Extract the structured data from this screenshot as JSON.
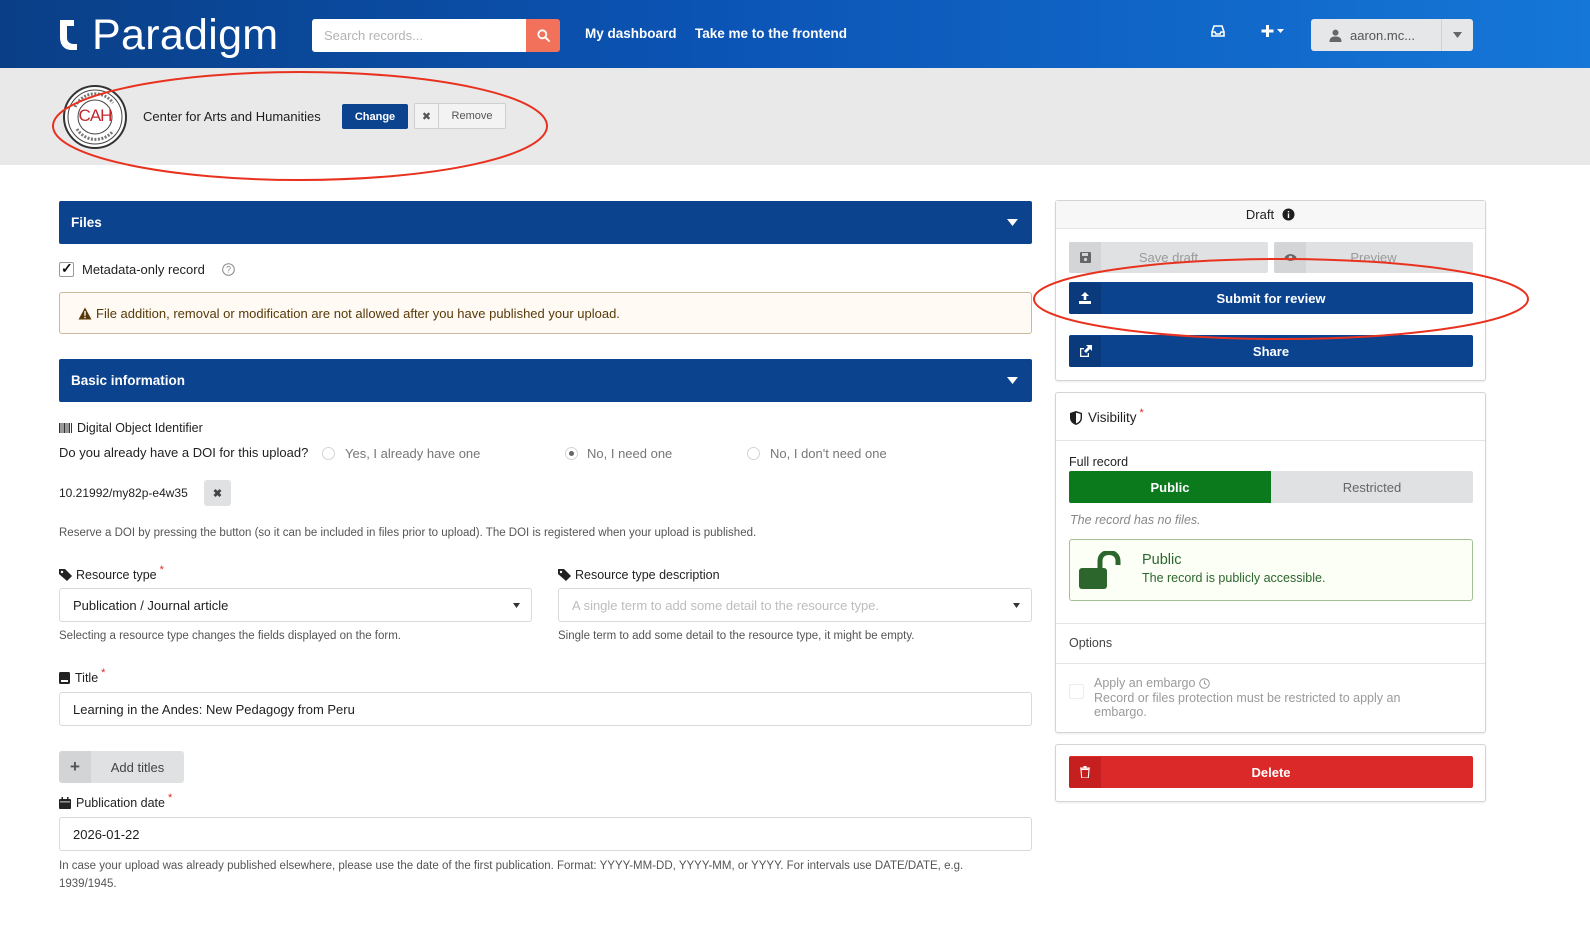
{
  "header": {
    "brand": "Paradigm",
    "search_placeholder": "Search records...",
    "nav": [
      "My dashboard",
      "Take me to the frontend"
    ],
    "user": "aaron.mc..."
  },
  "community": {
    "seal_text": "CAH",
    "name": "Center for Arts and Humanities",
    "change_label": "Change",
    "remove_label": "Remove"
  },
  "files": {
    "title": "Files",
    "metadata_only_label": "Metadata-only record",
    "metadata_only_checked": true,
    "warning": "File addition, removal or modification are not allowed after you have published your upload."
  },
  "basic": {
    "title": "Basic information",
    "doi_label": "Digital Object Identifier",
    "doi_question": "Do you already have a DOI for this upload?",
    "doi_options": [
      "Yes, I already have one",
      "No, I need one",
      "No, I don't need one"
    ],
    "doi_selected": 1,
    "doi_value": "10.21992/my82p-e4w35",
    "doi_help": "Reserve a DOI by pressing the button (so it can be included in files prior to upload). The DOI is registered when your upload is published.",
    "resource_type_label": "Resource type",
    "resource_type_value": "Publication / Journal article",
    "resource_type_help": "Selecting a resource type changes the fields displayed on the form.",
    "resource_desc_label": "Resource type description",
    "resource_desc_placeholder": "A single term to add some detail to the resource type.",
    "resource_desc_help": "Single term to add some detail to the resource type, it might be empty.",
    "title_label": "Title",
    "title_value": "Learning in the Andes: New Pedagogy from Peru",
    "add_titles_label": "Add titles",
    "pubdate_label": "Publication date",
    "pubdate_value": "2026-01-22",
    "pubdate_help_1": "In case your upload was already published elsewhere, please use the date of the first publication. Format: YYYY-MM-DD, YYYY-MM, or YYYY. For intervals use DATE/DATE, e.g.",
    "pubdate_help_2": "1939/1945."
  },
  "sidebar": {
    "status": "Draft",
    "save_draft": "Save draft",
    "preview": "Preview",
    "submit": "Submit for review",
    "share": "Share",
    "visibility_title": "Visibility",
    "full_record_label": "Full record",
    "public_label": "Public",
    "restricted_label": "Restricted",
    "no_files_note": "The record has no files.",
    "public_box_title": "Public",
    "public_box_desc": "The record is publicly accessible.",
    "options_label": "Options",
    "embargo_label": "Apply an embargo",
    "embargo_desc_1": "Record or files protection must be restricted to apply an",
    "embargo_desc_2": "embargo.",
    "delete": "Delete"
  },
  "colors": {
    "primary": "#0b438f",
    "search_button": "#f1715a",
    "public_green": "#0b7a1c",
    "danger": "#db2828",
    "annotation_red": "#e8321f"
  }
}
